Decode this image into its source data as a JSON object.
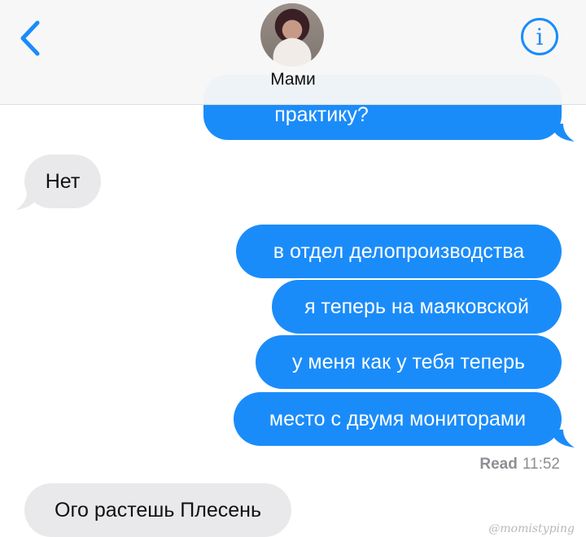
{
  "header": {
    "contact_name": "Мами",
    "back_icon": "chevron-left-icon",
    "info_icon": "i",
    "accent_color": "#1a8cfa"
  },
  "messages": [
    {
      "direction": "outgoing",
      "text": "практику?"
    },
    {
      "direction": "incoming",
      "text": "Нет"
    },
    {
      "direction": "outgoing",
      "text": "в отдел делопроизводства"
    },
    {
      "direction": "outgoing",
      "text": "я теперь на маяковской"
    },
    {
      "direction": "outgoing",
      "text": "у меня как у тебя теперь"
    },
    {
      "direction": "outgoing",
      "text": "место с двумя мониторами"
    },
    {
      "direction": "incoming",
      "text": "Ого растешь Плесень"
    }
  ],
  "receipt": {
    "label": "Read",
    "time": "11:52"
  },
  "watermark": "@momistyping",
  "colors": {
    "outgoing": "#1a8cfa",
    "incoming": "#e9e9eb"
  }
}
